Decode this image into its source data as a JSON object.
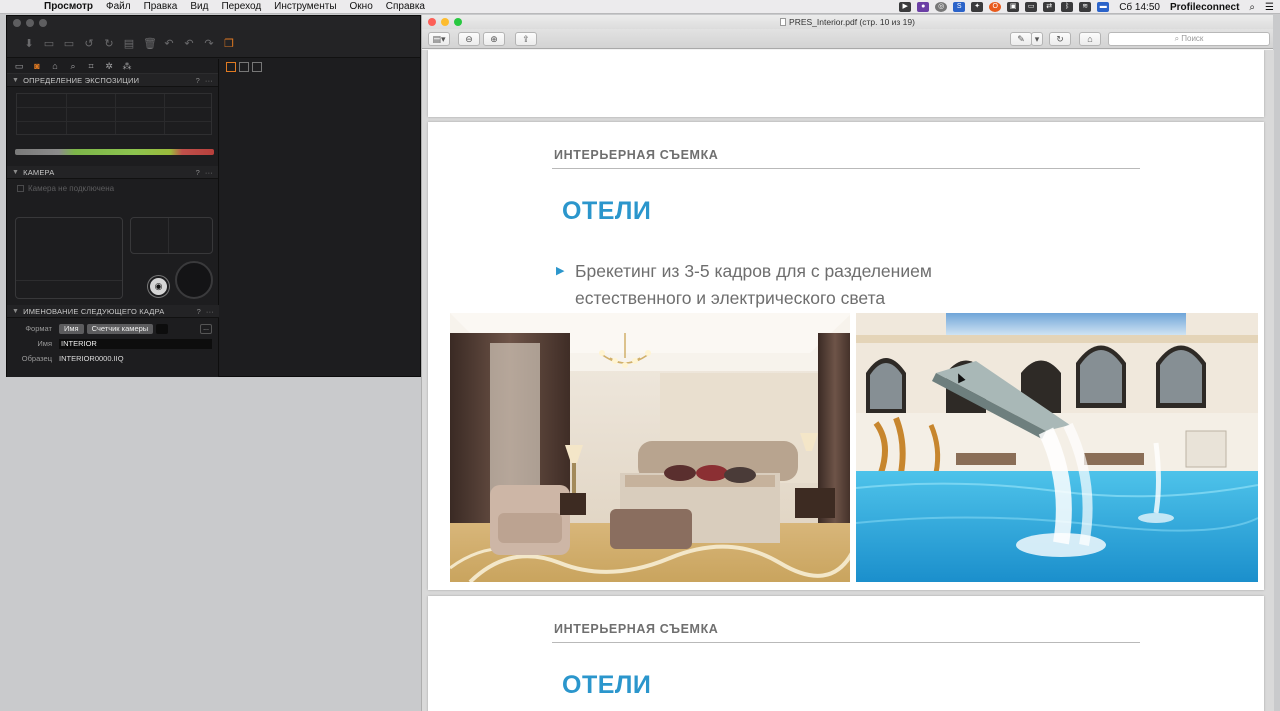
{
  "menubar": {
    "apple": "",
    "items": [
      "Просмотр",
      "Файл",
      "Правка",
      "Вид",
      "Переход",
      "Инструменты",
      "Окно",
      "Справка"
    ],
    "clock": "Сб 14:50",
    "user": "Profileconnect"
  },
  "capture_one": {
    "sections": {
      "exposure": "ОПРЕДЕЛЕНИЕ ЭКСПОЗИЦИИ",
      "camera": "КАМЕРА",
      "naming": "ИМЕНОВАНИЕ СЛЕДУЮЩЕГО КАДРА"
    },
    "help": "?",
    "more": "···",
    "camera_status": "Камера не подключена",
    "naming": {
      "format_label": "Формат",
      "format_tokens": [
        "Имя",
        "Счетчик камеры"
      ],
      "name_label": "Имя",
      "name_value": "INTERIOR",
      "sample_label": "Образец",
      "sample_value": "INTERIOR0000.IIQ",
      "dots": "..."
    }
  },
  "preview": {
    "title": "PRES_Interior.pdf (стр. 10 из 19)",
    "search_placeholder": "Поиск",
    "pages": [
      {
        "kicker": "ИНТЕРЬЕРНАЯ СЪЕМКА",
        "heading": "ОТЕЛИ",
        "bullet": [
          "Брекетинг из 3-5 кадров для с разделением",
          "естественного и электрического света"
        ]
      },
      {
        "kicker": "ИНТЕРЬЕРНАЯ СЪЕМКА",
        "heading": "ОТЕЛИ"
      }
    ]
  },
  "colors": {
    "accent_blue": "#2b96cc",
    "capture_orange": "#e07a22"
  }
}
